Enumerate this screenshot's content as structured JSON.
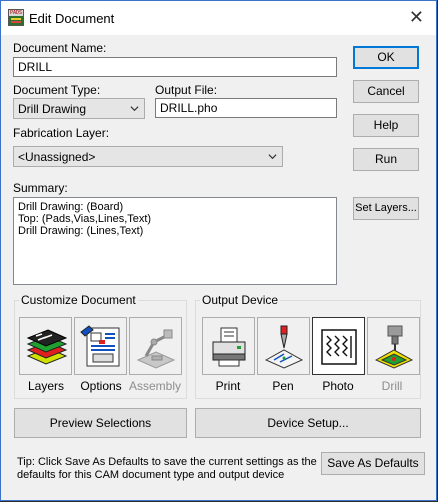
{
  "window": {
    "title": "Edit Document",
    "close_icon": "close-icon"
  },
  "fields": {
    "document_name_label": "Document Name:",
    "document_name_value": "DRILL",
    "document_type_label": "Document Type:",
    "document_type_value": "Drill Drawing",
    "output_file_label": "Output File:",
    "output_file_value": "DRILL.pho",
    "fabrication_layer_label": "Fabrication Layer:",
    "fabrication_layer_value": "<Unassigned>",
    "summary_label": "Summary:",
    "summary_lines": [
      "Drill Drawing: (Board)",
      "Top: (Pads,Vias,Lines,Text)",
      "Drill Drawing: (Lines,Text)"
    ]
  },
  "buttons": {
    "ok": "OK",
    "cancel": "Cancel",
    "help": "Help",
    "run": "Run",
    "set_layers": "Set Layers...",
    "preview_selections": "Preview Selections",
    "device_setup": "Device Setup...",
    "save_as_defaults": "Save As Defaults"
  },
  "customize": {
    "title": "Customize Document",
    "items": [
      {
        "label": "Layers",
        "icon": "layers-icon",
        "enabled": true
      },
      {
        "label": "Options",
        "icon": "options-icon",
        "enabled": true
      },
      {
        "label": "Assembly",
        "icon": "assembly-icon",
        "enabled": false
      }
    ]
  },
  "output_device": {
    "title": "Output Device",
    "items": [
      {
        "label": "Print",
        "icon": "printer-icon",
        "enabled": true
      },
      {
        "label": "Pen",
        "icon": "pen-plotter-icon",
        "enabled": true
      },
      {
        "label": "Photo",
        "icon": "photo-plotter-icon",
        "enabled": true,
        "selected": true
      },
      {
        "label": "Drill",
        "icon": "drill-icon",
        "enabled": false
      }
    ]
  },
  "tip": "Tip: Click Save As Defaults to save the current settings as the defaults for this CAM document type and output device",
  "colors": {
    "accent": "#0078d7",
    "window_border": "#3a73c9",
    "bg_red": "#e02020"
  }
}
